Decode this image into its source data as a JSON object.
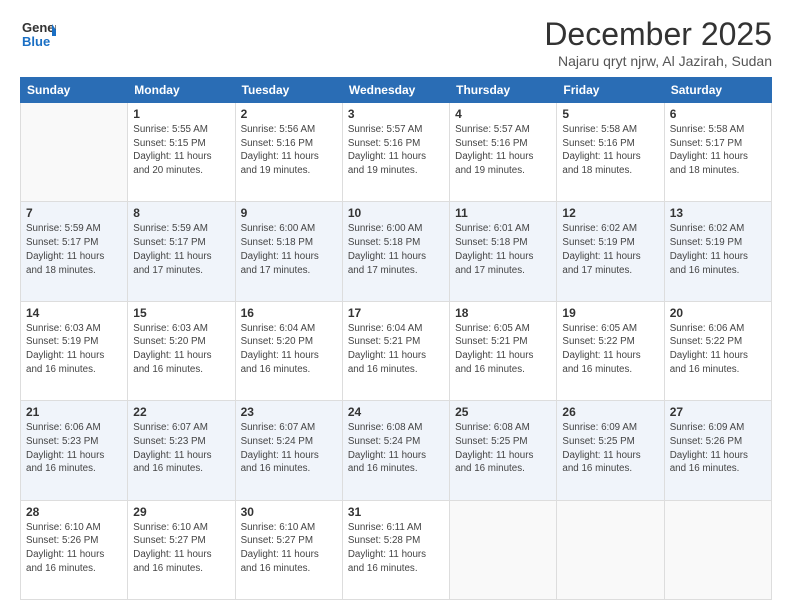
{
  "logo": {
    "general": "General",
    "blue": "Blue"
  },
  "title": "December 2025",
  "subtitle": "Najaru qryt njrw, Al Jazirah, Sudan",
  "days_of_week": [
    "Sunday",
    "Monday",
    "Tuesday",
    "Wednesday",
    "Thursday",
    "Friday",
    "Saturday"
  ],
  "weeks": [
    [
      {
        "day": "",
        "sunrise": "",
        "sunset": "",
        "daylight": ""
      },
      {
        "day": "1",
        "sunrise": "Sunrise: 5:55 AM",
        "sunset": "Sunset: 5:15 PM",
        "daylight": "Daylight: 11 hours and 20 minutes."
      },
      {
        "day": "2",
        "sunrise": "Sunrise: 5:56 AM",
        "sunset": "Sunset: 5:16 PM",
        "daylight": "Daylight: 11 hours and 19 minutes."
      },
      {
        "day": "3",
        "sunrise": "Sunrise: 5:57 AM",
        "sunset": "Sunset: 5:16 PM",
        "daylight": "Daylight: 11 hours and 19 minutes."
      },
      {
        "day": "4",
        "sunrise": "Sunrise: 5:57 AM",
        "sunset": "Sunset: 5:16 PM",
        "daylight": "Daylight: 11 hours and 19 minutes."
      },
      {
        "day": "5",
        "sunrise": "Sunrise: 5:58 AM",
        "sunset": "Sunset: 5:16 PM",
        "daylight": "Daylight: 11 hours and 18 minutes."
      },
      {
        "day": "6",
        "sunrise": "Sunrise: 5:58 AM",
        "sunset": "Sunset: 5:17 PM",
        "daylight": "Daylight: 11 hours and 18 minutes."
      }
    ],
    [
      {
        "day": "7",
        "sunrise": "Sunrise: 5:59 AM",
        "sunset": "Sunset: 5:17 PM",
        "daylight": "Daylight: 11 hours and 18 minutes."
      },
      {
        "day": "8",
        "sunrise": "Sunrise: 5:59 AM",
        "sunset": "Sunset: 5:17 PM",
        "daylight": "Daylight: 11 hours and 17 minutes."
      },
      {
        "day": "9",
        "sunrise": "Sunrise: 6:00 AM",
        "sunset": "Sunset: 5:18 PM",
        "daylight": "Daylight: 11 hours and 17 minutes."
      },
      {
        "day": "10",
        "sunrise": "Sunrise: 6:00 AM",
        "sunset": "Sunset: 5:18 PM",
        "daylight": "Daylight: 11 hours and 17 minutes."
      },
      {
        "day": "11",
        "sunrise": "Sunrise: 6:01 AM",
        "sunset": "Sunset: 5:18 PM",
        "daylight": "Daylight: 11 hours and 17 minutes."
      },
      {
        "day": "12",
        "sunrise": "Sunrise: 6:02 AM",
        "sunset": "Sunset: 5:19 PM",
        "daylight": "Daylight: 11 hours and 17 minutes."
      },
      {
        "day": "13",
        "sunrise": "Sunrise: 6:02 AM",
        "sunset": "Sunset: 5:19 PM",
        "daylight": "Daylight: 11 hours and 16 minutes."
      }
    ],
    [
      {
        "day": "14",
        "sunrise": "Sunrise: 6:03 AM",
        "sunset": "Sunset: 5:19 PM",
        "daylight": "Daylight: 11 hours and 16 minutes."
      },
      {
        "day": "15",
        "sunrise": "Sunrise: 6:03 AM",
        "sunset": "Sunset: 5:20 PM",
        "daylight": "Daylight: 11 hours and 16 minutes."
      },
      {
        "day": "16",
        "sunrise": "Sunrise: 6:04 AM",
        "sunset": "Sunset: 5:20 PM",
        "daylight": "Daylight: 11 hours and 16 minutes."
      },
      {
        "day": "17",
        "sunrise": "Sunrise: 6:04 AM",
        "sunset": "Sunset: 5:21 PM",
        "daylight": "Daylight: 11 hours and 16 minutes."
      },
      {
        "day": "18",
        "sunrise": "Sunrise: 6:05 AM",
        "sunset": "Sunset: 5:21 PM",
        "daylight": "Daylight: 11 hours and 16 minutes."
      },
      {
        "day": "19",
        "sunrise": "Sunrise: 6:05 AM",
        "sunset": "Sunset: 5:22 PM",
        "daylight": "Daylight: 11 hours and 16 minutes."
      },
      {
        "day": "20",
        "sunrise": "Sunrise: 6:06 AM",
        "sunset": "Sunset: 5:22 PM",
        "daylight": "Daylight: 11 hours and 16 minutes."
      }
    ],
    [
      {
        "day": "21",
        "sunrise": "Sunrise: 6:06 AM",
        "sunset": "Sunset: 5:23 PM",
        "daylight": "Daylight: 11 hours and 16 minutes."
      },
      {
        "day": "22",
        "sunrise": "Sunrise: 6:07 AM",
        "sunset": "Sunset: 5:23 PM",
        "daylight": "Daylight: 11 hours and 16 minutes."
      },
      {
        "day": "23",
        "sunrise": "Sunrise: 6:07 AM",
        "sunset": "Sunset: 5:24 PM",
        "daylight": "Daylight: 11 hours and 16 minutes."
      },
      {
        "day": "24",
        "sunrise": "Sunrise: 6:08 AM",
        "sunset": "Sunset: 5:24 PM",
        "daylight": "Daylight: 11 hours and 16 minutes."
      },
      {
        "day": "25",
        "sunrise": "Sunrise: 6:08 AM",
        "sunset": "Sunset: 5:25 PM",
        "daylight": "Daylight: 11 hours and 16 minutes."
      },
      {
        "day": "26",
        "sunrise": "Sunrise: 6:09 AM",
        "sunset": "Sunset: 5:25 PM",
        "daylight": "Daylight: 11 hours and 16 minutes."
      },
      {
        "day": "27",
        "sunrise": "Sunrise: 6:09 AM",
        "sunset": "Sunset: 5:26 PM",
        "daylight": "Daylight: 11 hours and 16 minutes."
      }
    ],
    [
      {
        "day": "28",
        "sunrise": "Sunrise: 6:10 AM",
        "sunset": "Sunset: 5:26 PM",
        "daylight": "Daylight: 11 hours and 16 minutes."
      },
      {
        "day": "29",
        "sunrise": "Sunrise: 6:10 AM",
        "sunset": "Sunset: 5:27 PM",
        "daylight": "Daylight: 11 hours and 16 minutes."
      },
      {
        "day": "30",
        "sunrise": "Sunrise: 6:10 AM",
        "sunset": "Sunset: 5:27 PM",
        "daylight": "Daylight: 11 hours and 16 minutes."
      },
      {
        "day": "31",
        "sunrise": "Sunrise: 6:11 AM",
        "sunset": "Sunset: 5:28 PM",
        "daylight": "Daylight: 11 hours and 16 minutes."
      },
      {
        "day": "",
        "sunrise": "",
        "sunset": "",
        "daylight": ""
      },
      {
        "day": "",
        "sunrise": "",
        "sunset": "",
        "daylight": ""
      },
      {
        "day": "",
        "sunrise": "",
        "sunset": "",
        "daylight": ""
      }
    ]
  ]
}
